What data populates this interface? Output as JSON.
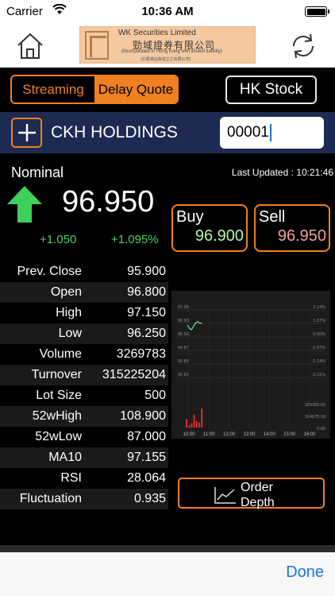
{
  "status": {
    "carrier": "Carrier",
    "time": "10:36 AM"
  },
  "logo": {
    "name_en": "WK Securities Limited",
    "name_zh": "勁域證券有限公司",
    "tagline": "(Incorporated in Hong Kong with limited liability)",
    "tagline_zh": "(於香港註冊成立之有限公司)"
  },
  "toolbar": {
    "streaming_label": "Streaming",
    "delay_label": "Delay Quote",
    "market_label": "HK Stock",
    "active_mode": "Delay Quote"
  },
  "stock": {
    "name": "CKH HOLDINGS",
    "code": "00001"
  },
  "quote": {
    "nominal_label": "Nominal",
    "last_updated": "Last Updated : 10:21:46",
    "price": "96.950",
    "change": "+1.050",
    "change_pct": "+1.095%",
    "buy_label": "Buy",
    "buy_value": "96.900",
    "sell_label": "Sell",
    "sell_value": "96.950"
  },
  "stats": [
    {
      "label": "Prev. Close",
      "value": "95.900"
    },
    {
      "label": "Open",
      "value": "96.800"
    },
    {
      "label": "High",
      "value": "97.150"
    },
    {
      "label": "Low",
      "value": "96.250"
    },
    {
      "label": "Volume",
      "value": "3269783"
    },
    {
      "label": "Turnover",
      "value": "315225204"
    },
    {
      "label": "Lot Size",
      "value": "500"
    },
    {
      "label": "52wHigh",
      "value": "108.900"
    },
    {
      "label": "52wLow",
      "value": "87.000"
    },
    {
      "label": "MA10",
      "value": "97.155"
    },
    {
      "label": "RSI",
      "value": "28.064"
    },
    {
      "label": "Fluctuation",
      "value": "0.935"
    }
  ],
  "order_depth": {
    "line1": "Order",
    "line2": "Depth"
  },
  "done_label": "Done",
  "colors": {
    "accent": "#f08020",
    "up": "#4bd26c",
    "stock_bar": "#1d2a52"
  },
  "chart_data": {
    "type": "line",
    "x": [
      "10:00",
      "11:00",
      "12:00",
      "13:00",
      "14:00",
      "15:00",
      "16:00"
    ],
    "price_ticks": [
      "97.95",
      "96.93",
      "95.90",
      "94.87",
      "93.85",
      "92.82"
    ],
    "pct_ticks": [
      "2.14%",
      "1.07%",
      "0.00%",
      "-1.07%",
      "-2.14%",
      "-3.21%"
    ],
    "volume_ticks": [
      "329350.00",
      "164675.00",
      "0.00"
    ],
    "price_series": [
      {
        "t": "10:00",
        "v": 96.8
      },
      {
        "t": "10:03",
        "v": 96.55
      },
      {
        "t": "10:06",
        "v": 96.45
      },
      {
        "t": "10:09",
        "v": 96.7
      },
      {
        "t": "10:12",
        "v": 96.95
      },
      {
        "t": "10:15",
        "v": 97.05
      },
      {
        "t": "10:18",
        "v": 96.95
      },
      {
        "t": "10:21",
        "v": 96.95
      }
    ],
    "volume_bars": [
      120000,
      30000,
      60000,
      180000,
      90000,
      70000,
      260000
    ]
  }
}
